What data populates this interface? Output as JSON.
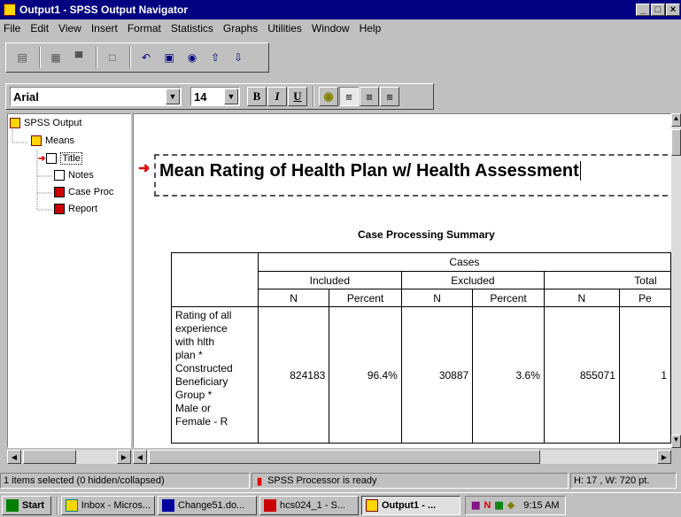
{
  "window": {
    "title": "Output1 - SPSS Output Navigator",
    "min": "_",
    "max": "□",
    "close": "×"
  },
  "menu": [
    "File",
    "Edit",
    "View",
    "Insert",
    "Format",
    "Statistics",
    "Graphs",
    "Utilities",
    "Window",
    "Help"
  ],
  "format_toolbar": {
    "font": "Arial",
    "size": "14",
    "bold": "B",
    "italic": "I",
    "underline": "U"
  },
  "outline": {
    "root": "SPSS Output",
    "group": "Means",
    "items": [
      "Title",
      "Notes",
      "Case Proc",
      "Report"
    ]
  },
  "document": {
    "title": "Mean Rating of Health Plan w/ Health Assessment",
    "table_title": "Case Processing Summary",
    "cases_header": "Cases",
    "groups": [
      "Included",
      "Excluded",
      "Total"
    ],
    "sub_headers": [
      "N",
      "Percent",
      "N",
      "Percent",
      "N",
      "Pe"
    ],
    "row_label": [
      "Rating of all",
      "experience",
      "with hlth",
      "plan *",
      "Constructed",
      "Beneficiary",
      "Group *",
      "Male or",
      "Female  - R"
    ],
    "row_values": [
      "824183",
      "96.4%",
      "30887",
      "3.6%",
      "855071",
      "1"
    ]
  },
  "status": {
    "selection": "1 items selected (0 hidden/collapsed)",
    "processor": "SPSS Processor is ready",
    "dims": "H: 17 , W: 720  pt."
  },
  "taskbar": {
    "start": "Start",
    "tasks": [
      "Inbox - Micros...",
      "Change51.do...",
      "hcs024_1 - S...",
      "Output1 - ..."
    ],
    "clock": "9:15 AM"
  },
  "colors": {
    "titlebar": "#000080",
    "face": "#c0c0c0",
    "accent_arrow": "#e00000"
  }
}
